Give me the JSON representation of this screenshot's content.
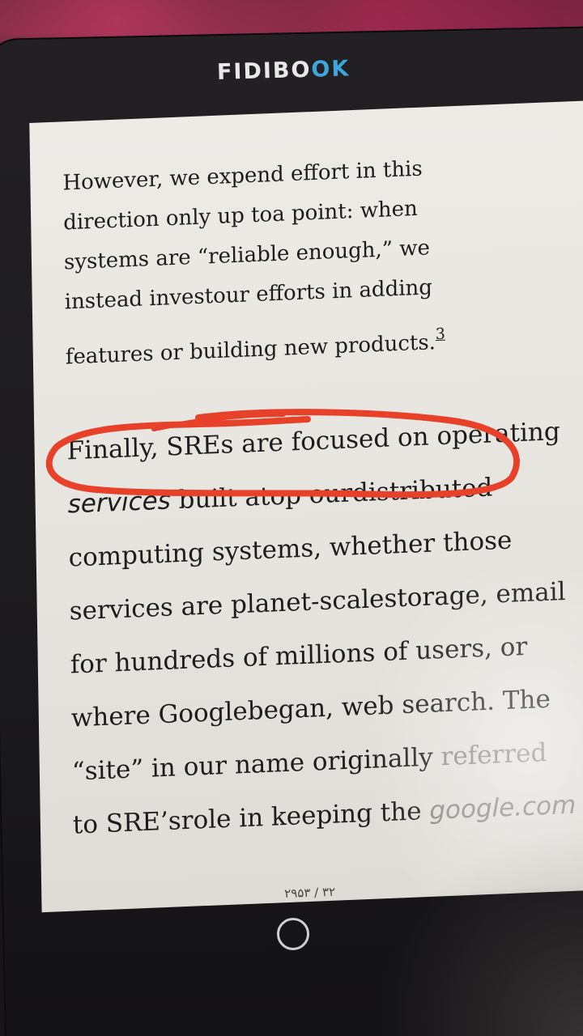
{
  "device": {
    "brand_left": "FIDIBO",
    "brand_right": "OK",
    "brand_accent_color": "#3fa6dc"
  },
  "book": {
    "paragraph_1": [
      "However, we expend effort in this",
      "direction only up toa point: when",
      "systems are “reliable enough,” we",
      "instead investour efforts in adding",
      "features or building new products."
    ],
    "footnote_ref": "3",
    "paragraph_2": {
      "line_1": "Finally, SREs are focused on operating",
      "line_2_italic": "services",
      "line_2_rest": " built atop ourdistributed",
      "line_3": "computing systems, whether those",
      "line_4": "services are planet-scalestorage, email",
      "line_5": "for hundreds of millions of users, or",
      "line_6": "where Googlebegan, web search. The",
      "line_7_a": "“site” in our name originally ",
      "line_7_b": "referred",
      "line_8_a": "to SRE’srole in keeping the ",
      "line_8_italic": "google.com"
    }
  },
  "page_indicator": "۳۲ / ۲۹۵۳",
  "annotation": {
    "color": "#e8412a",
    "icon": "freehand-red-circle"
  },
  "controls": {
    "home_icon": "circle-home-icon"
  }
}
